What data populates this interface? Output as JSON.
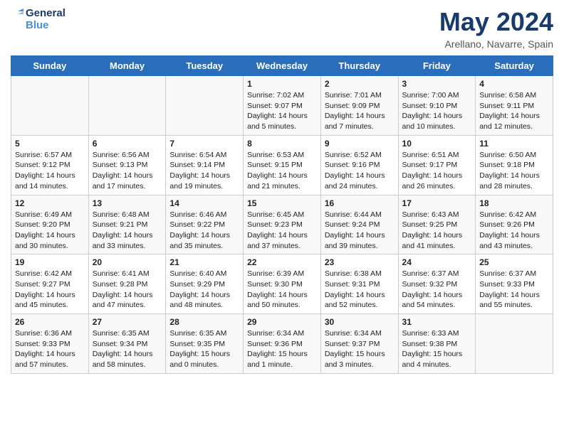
{
  "header": {
    "logo_line1": "General",
    "logo_line2": "Blue",
    "month": "May 2024",
    "location": "Arellano, Navarre, Spain"
  },
  "weekdays": [
    "Sunday",
    "Monday",
    "Tuesday",
    "Wednesday",
    "Thursday",
    "Friday",
    "Saturday"
  ],
  "weeks": [
    [
      {
        "day": "",
        "info": ""
      },
      {
        "day": "",
        "info": ""
      },
      {
        "day": "",
        "info": ""
      },
      {
        "day": "1",
        "info": "Sunrise: 7:02 AM\nSunset: 9:07 PM\nDaylight: 14 hours\nand 5 minutes."
      },
      {
        "day": "2",
        "info": "Sunrise: 7:01 AM\nSunset: 9:09 PM\nDaylight: 14 hours\nand 7 minutes."
      },
      {
        "day": "3",
        "info": "Sunrise: 7:00 AM\nSunset: 9:10 PM\nDaylight: 14 hours\nand 10 minutes."
      },
      {
        "day": "4",
        "info": "Sunrise: 6:58 AM\nSunset: 9:11 PM\nDaylight: 14 hours\nand 12 minutes."
      }
    ],
    [
      {
        "day": "5",
        "info": "Sunrise: 6:57 AM\nSunset: 9:12 PM\nDaylight: 14 hours\nand 14 minutes."
      },
      {
        "day": "6",
        "info": "Sunrise: 6:56 AM\nSunset: 9:13 PM\nDaylight: 14 hours\nand 17 minutes."
      },
      {
        "day": "7",
        "info": "Sunrise: 6:54 AM\nSunset: 9:14 PM\nDaylight: 14 hours\nand 19 minutes."
      },
      {
        "day": "8",
        "info": "Sunrise: 6:53 AM\nSunset: 9:15 PM\nDaylight: 14 hours\nand 21 minutes."
      },
      {
        "day": "9",
        "info": "Sunrise: 6:52 AM\nSunset: 9:16 PM\nDaylight: 14 hours\nand 24 minutes."
      },
      {
        "day": "10",
        "info": "Sunrise: 6:51 AM\nSunset: 9:17 PM\nDaylight: 14 hours\nand 26 minutes."
      },
      {
        "day": "11",
        "info": "Sunrise: 6:50 AM\nSunset: 9:18 PM\nDaylight: 14 hours\nand 28 minutes."
      }
    ],
    [
      {
        "day": "12",
        "info": "Sunrise: 6:49 AM\nSunset: 9:20 PM\nDaylight: 14 hours\nand 30 minutes."
      },
      {
        "day": "13",
        "info": "Sunrise: 6:48 AM\nSunset: 9:21 PM\nDaylight: 14 hours\nand 33 minutes."
      },
      {
        "day": "14",
        "info": "Sunrise: 6:46 AM\nSunset: 9:22 PM\nDaylight: 14 hours\nand 35 minutes."
      },
      {
        "day": "15",
        "info": "Sunrise: 6:45 AM\nSunset: 9:23 PM\nDaylight: 14 hours\nand 37 minutes."
      },
      {
        "day": "16",
        "info": "Sunrise: 6:44 AM\nSunset: 9:24 PM\nDaylight: 14 hours\nand 39 minutes."
      },
      {
        "day": "17",
        "info": "Sunrise: 6:43 AM\nSunset: 9:25 PM\nDaylight: 14 hours\nand 41 minutes."
      },
      {
        "day": "18",
        "info": "Sunrise: 6:42 AM\nSunset: 9:26 PM\nDaylight: 14 hours\nand 43 minutes."
      }
    ],
    [
      {
        "day": "19",
        "info": "Sunrise: 6:42 AM\nSunset: 9:27 PM\nDaylight: 14 hours\nand 45 minutes."
      },
      {
        "day": "20",
        "info": "Sunrise: 6:41 AM\nSunset: 9:28 PM\nDaylight: 14 hours\nand 47 minutes."
      },
      {
        "day": "21",
        "info": "Sunrise: 6:40 AM\nSunset: 9:29 PM\nDaylight: 14 hours\nand 48 minutes."
      },
      {
        "day": "22",
        "info": "Sunrise: 6:39 AM\nSunset: 9:30 PM\nDaylight: 14 hours\nand 50 minutes."
      },
      {
        "day": "23",
        "info": "Sunrise: 6:38 AM\nSunset: 9:31 PM\nDaylight: 14 hours\nand 52 minutes."
      },
      {
        "day": "24",
        "info": "Sunrise: 6:37 AM\nSunset: 9:32 PM\nDaylight: 14 hours\nand 54 minutes."
      },
      {
        "day": "25",
        "info": "Sunrise: 6:37 AM\nSunset: 9:33 PM\nDaylight: 14 hours\nand 55 minutes."
      }
    ],
    [
      {
        "day": "26",
        "info": "Sunrise: 6:36 AM\nSunset: 9:33 PM\nDaylight: 14 hours\nand 57 minutes."
      },
      {
        "day": "27",
        "info": "Sunrise: 6:35 AM\nSunset: 9:34 PM\nDaylight: 14 hours\nand 58 minutes."
      },
      {
        "day": "28",
        "info": "Sunrise: 6:35 AM\nSunset: 9:35 PM\nDaylight: 15 hours\nand 0 minutes."
      },
      {
        "day": "29",
        "info": "Sunrise: 6:34 AM\nSunset: 9:36 PM\nDaylight: 15 hours\nand 1 minute."
      },
      {
        "day": "30",
        "info": "Sunrise: 6:34 AM\nSunset: 9:37 PM\nDaylight: 15 hours\nand 3 minutes."
      },
      {
        "day": "31",
        "info": "Sunrise: 6:33 AM\nSunset: 9:38 PM\nDaylight: 15 hours\nand 4 minutes."
      },
      {
        "day": "",
        "info": ""
      }
    ]
  ]
}
